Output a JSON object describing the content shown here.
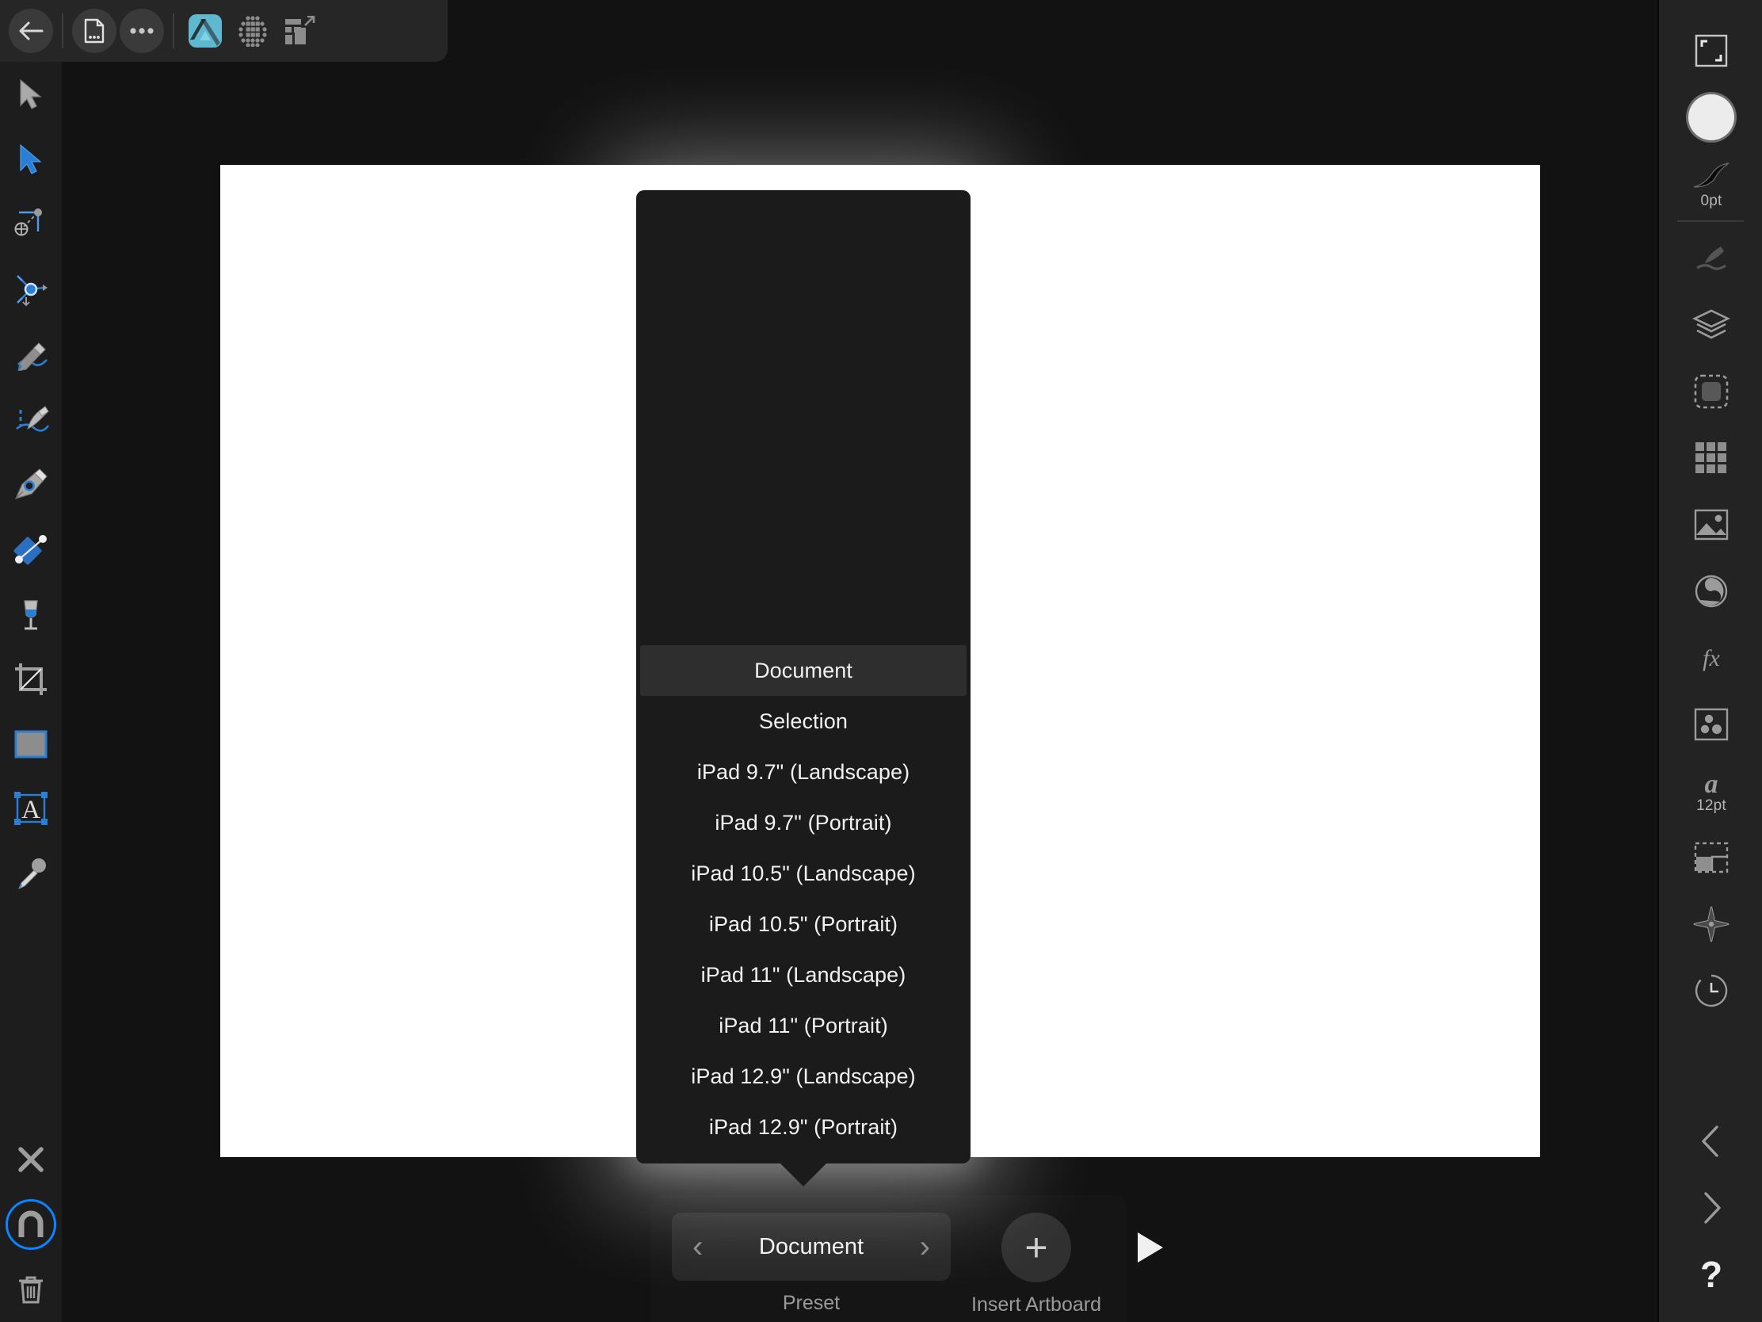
{
  "app": {
    "name": "Affinity Designer",
    "accent": "#0a84ff",
    "bg": "#121212",
    "panel_bg": "#1d1d1d",
    "popover_bg": "#1b1b1b"
  },
  "topbar": {
    "items": [
      {
        "name": "back-arrow-icon",
        "label": "Back"
      },
      {
        "name": "document-menu-icon",
        "label": "Document Menu"
      },
      {
        "name": "more-options-icon",
        "label": "More"
      },
      {
        "name": "affinity-designer-persona-icon",
        "label": "Designer Persona"
      },
      {
        "name": "pixel-persona-icon",
        "label": "Pixel Persona"
      },
      {
        "name": "export-persona-icon",
        "label": "Export Persona"
      }
    ]
  },
  "tools": [
    {
      "name": "move-tool",
      "label": "Move Tool"
    },
    {
      "name": "node-tool",
      "label": "Node Tool"
    },
    {
      "name": "corner-tool",
      "label": "Corner Tool"
    },
    {
      "name": "transform-tool",
      "label": "Point Transform Tool"
    },
    {
      "name": "pencil-tool",
      "label": "Pencil Tool"
    },
    {
      "name": "vector-brush-tool",
      "label": "Vector Brush Tool"
    },
    {
      "name": "pen-tool",
      "label": "Pen Tool"
    },
    {
      "name": "fill-tool",
      "label": "Fill Tool"
    },
    {
      "name": "flood-fill-tool",
      "label": "Flood Fill Tool"
    },
    {
      "name": "crop-tool",
      "label": "Artboard Tool"
    },
    {
      "name": "rectangle-tool",
      "label": "Rectangle Tool"
    },
    {
      "name": "text-frame-tool",
      "label": "Frame Text Tool"
    },
    {
      "name": "colour-picker-tool",
      "label": "Colour Picker Tool"
    }
  ],
  "tools_bottom": [
    {
      "name": "close-icon",
      "label": "Deselect"
    },
    {
      "name": "magnet-snapping-icon",
      "label": "Snapping",
      "active": true
    },
    {
      "name": "trash-icon",
      "label": "Delete"
    }
  ],
  "right_rail": {
    "items": [
      {
        "name": "document-bounds-icon",
        "label": ""
      },
      {
        "name": "colour-swatch-icon",
        "label": ""
      },
      {
        "name": "stroke-width-icon",
        "label": "0pt"
      },
      {
        "name": "brushes-icon",
        "label": ""
      },
      {
        "name": "layers-icon",
        "label": ""
      },
      {
        "name": "selection-icon",
        "label": ""
      },
      {
        "name": "swatches-grid-icon",
        "label": ""
      },
      {
        "name": "image-placement-icon",
        "label": ""
      },
      {
        "name": "adjustment-icon",
        "label": ""
      },
      {
        "name": "effects-fx-icon",
        "label": ""
      },
      {
        "name": "assets-icon",
        "label": ""
      },
      {
        "name": "character-text-icon",
        "label": "12pt"
      },
      {
        "name": "transform-panel-icon",
        "label": ""
      },
      {
        "name": "navigator-icon",
        "label": ""
      },
      {
        "name": "history-icon",
        "label": ""
      }
    ],
    "footer": [
      {
        "name": "undo-chevron-left-icon",
        "label": ""
      },
      {
        "name": "redo-chevron-right-icon",
        "label": ""
      },
      {
        "name": "help-question-icon",
        "label": "?"
      }
    ]
  },
  "popover": {
    "name": "artboard-preset-menu",
    "selected": "Document",
    "items": [
      {
        "label": "Document",
        "selected": true
      },
      {
        "label": "Selection",
        "selected": false
      },
      {
        "label": "iPad 9.7\" (Landscape)",
        "selected": false
      },
      {
        "label": "iPad 9.7\" (Portrait)",
        "selected": false
      },
      {
        "label": "iPad 10.5\" (Landscape)",
        "selected": false
      },
      {
        "label": "iPad 10.5\" (Portrait)",
        "selected": false
      },
      {
        "label": "iPad 11\" (Landscape)",
        "selected": false
      },
      {
        "label": "iPad 11\" (Portrait)",
        "selected": false
      },
      {
        "label": "iPad 12.9\" (Landscape)",
        "selected": false
      },
      {
        "label": "iPad 12.9\" (Portrait)",
        "selected": false
      }
    ]
  },
  "bottombar": {
    "preset": {
      "value": "Document",
      "caption": "Preset",
      "prev_icon": "chevron-left-icon",
      "next_icon": "chevron-right-icon"
    },
    "insert_artboard": {
      "caption": "Insert Artboard",
      "icon": "plus-icon"
    },
    "play": {
      "name": "play-icon"
    }
  }
}
